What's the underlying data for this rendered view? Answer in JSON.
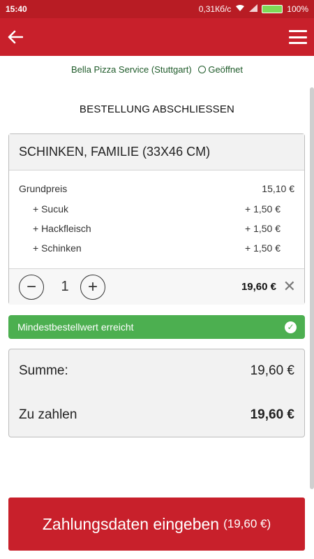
{
  "status_bar": {
    "time": "15:40",
    "speed": "0,31Кб/с",
    "battery": "100%"
  },
  "shop": {
    "name": "Bella Pizza Service (Stuttgart)",
    "status": "Geöffnet"
  },
  "page": {
    "title": "BESTELLUNG ABSCHLIESSEN"
  },
  "item": {
    "name": "SCHINKEN, FAMILIE (33X46 CM)",
    "base_label": "Grundpreis",
    "base_price": "15,10 €",
    "extras": [
      {
        "label": "+ Sucuk",
        "price": "+ 1,50 €"
      },
      {
        "label": "+ Hackfleisch",
        "price": "+ 1,50 €"
      },
      {
        "label": "+ Schinken",
        "price": "+ 1,50 €"
      }
    ],
    "quantity": "1",
    "minus_symbol": "−",
    "plus_symbol": "+",
    "total": "19,60 €",
    "remove_symbol": "✕"
  },
  "notice": {
    "text": "Mindestbestellwert erreicht",
    "check": "✓"
  },
  "summary": {
    "sum_label": "Summe:",
    "sum_value": "19,60 €",
    "pay_label": "Zu zahlen",
    "pay_value": "19,60 €"
  },
  "cta": {
    "label": "Zahlungsdaten eingeben",
    "amount": "(19,60 €)"
  },
  "icons": {
    "back": "arrow-left-icon",
    "menu": "hamburger-menu-icon",
    "clock": "clock-icon"
  },
  "colors": {
    "brand": "#c8202b",
    "success": "#4caf50",
    "shop_text": "#1f5b2a"
  }
}
